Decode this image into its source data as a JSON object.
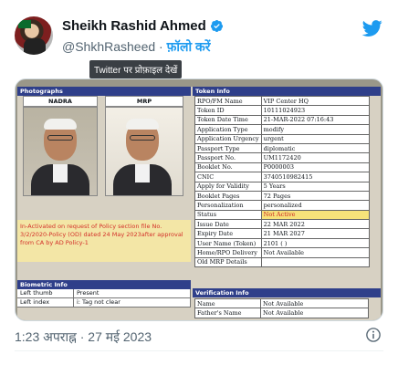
{
  "tweet": {
    "author_name": "Sheikh Rashid Ahmed",
    "handle": "@ShkhRasheed",
    "separator": " · ",
    "follow_label": "फ़ॉलो करें",
    "tooltip": "Twitter पर प्रोफ़ाइल देखें",
    "timestamp": "1:23 अपराह्न · 27 मई 2023"
  },
  "document": {
    "photographs_header": "Photographs",
    "token_header": "Token Info",
    "nadra_label": "NADRA",
    "mrp_label": "MRP",
    "red_note": "In-Activated on request of Policy section file No. 3/2/2020-Policy (OD) dated 24 May 2023after approval from CA by AD Policy-1",
    "token_rows": [
      {
        "k": "RPO/FM Name",
        "v": "VIP Center HQ"
      },
      {
        "k": "Token ID",
        "v": "10111024923"
      },
      {
        "k": "Token Date Time",
        "v": "21-MAR-2022 07:16:43"
      },
      {
        "k": "Application Type",
        "v": "modify"
      },
      {
        "k": "Application Urgency",
        "v": "urgent"
      },
      {
        "k": "Passport Type",
        "v": "diplomatic"
      },
      {
        "k": "Passport No.",
        "v": "UM1172420"
      },
      {
        "k": "Booklet No.",
        "v": "P0000003"
      },
      {
        "k": "CNIC",
        "v": "3740510982415"
      },
      {
        "k": "Apply for Validity",
        "v": "5 Years"
      },
      {
        "k": "Booklet Pages",
        "v": "72 Pages"
      },
      {
        "k": "Personalization",
        "v": "personalized"
      },
      {
        "k": "Status",
        "v": "Not Active"
      },
      {
        "k": "Issue Date",
        "v": "22 MAR 2022"
      },
      {
        "k": "Expiry Date",
        "v": "21 MAR 2027"
      },
      {
        "k": "User Name (Token)",
        "v": "2101 ( )"
      },
      {
        "k": "Home/RPO Delivery",
        "v": "Not Available"
      },
      {
        "k": "Old MRP Details",
        "v": ""
      }
    ],
    "verification_header": "Verification Info",
    "verification_rows": [
      {
        "k": "Name",
        "v": "Not Available"
      },
      {
        "k": "Father's Name",
        "v": "Not Available"
      }
    ],
    "biometric_header": "Biometric Info",
    "biometric_rows": [
      {
        "k": "Left thumb",
        "v": "Present"
      },
      {
        "k": "Left index",
        "v": "i: Tag not clear"
      }
    ]
  },
  "colors": {
    "brand_blue": "#1d9bf0",
    "header_navy": "#2f3f8a",
    "warning_red": "#d3302a"
  }
}
